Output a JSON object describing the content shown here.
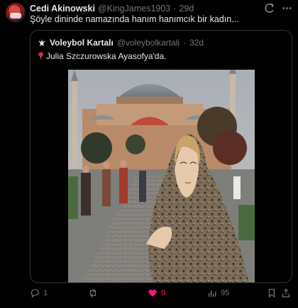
{
  "author": {
    "name": "Cedi Akinowski",
    "handle": "@KingJames1903",
    "separator": "·",
    "time": "29d"
  },
  "tweet": {
    "text": "Şöyle dininde namazında hanım hanımcık bir kadın..."
  },
  "quoted_tweet": {
    "author_name": "Voleybol Kartalı",
    "handle": "@voleybolkartali",
    "separator": "·",
    "time": "32d",
    "text": "Julia Szczurowska Ayasofya'da."
  },
  "actions": {
    "reply_count": "1",
    "repost_count": "",
    "like_count": "9",
    "view_count": "95"
  },
  "icons": [
    "grok-icon",
    "more-icon",
    "eagle-logo-icon",
    "pin-icon",
    "reply-icon",
    "repost-icon",
    "like-icon",
    "views-icon",
    "bookmark-icon",
    "share-icon"
  ],
  "colors": {
    "background": "#000000",
    "text": "#e7e9ea",
    "muted": "#71767b",
    "like": "#f91880",
    "border": "#2f3336"
  }
}
